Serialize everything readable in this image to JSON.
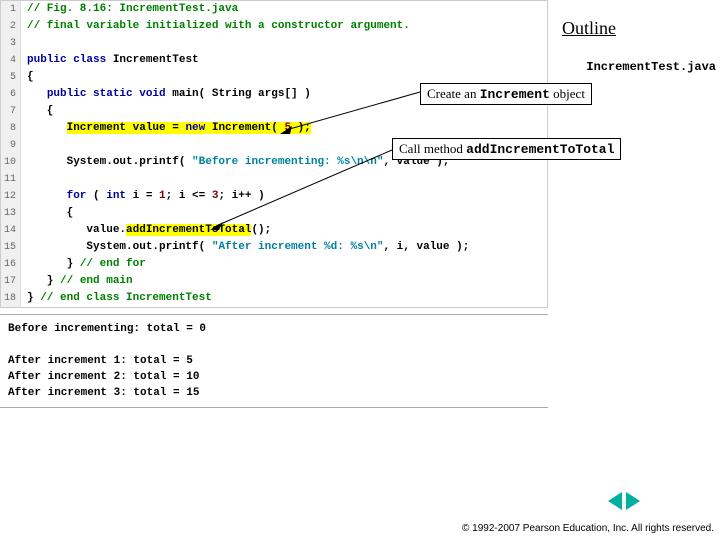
{
  "outline": "Outline",
  "filename": "IncrementTest.java",
  "code": [
    {
      "n": "1",
      "tokens": [
        {
          "t": "// Fig. 8.16: IncrementTest.java",
          "cls": "comment"
        }
      ]
    },
    {
      "n": "2",
      "tokens": [
        {
          "t": "// final variable initialized with a constructor argument.",
          "cls": "comment"
        }
      ]
    },
    {
      "n": "3",
      "tokens": []
    },
    {
      "n": "4",
      "tokens": [
        {
          "t": "public class ",
          "cls": "keyword"
        },
        {
          "t": "IncrementTest",
          "cls": "ident"
        }
      ]
    },
    {
      "n": "5",
      "tokens": [
        {
          "t": "{",
          "cls": "ident"
        }
      ]
    },
    {
      "n": "6",
      "tokens": [
        {
          "t": "   ",
          "cls": ""
        },
        {
          "t": "public static void ",
          "cls": "keyword"
        },
        {
          "t": "main",
          "cls": "ident"
        },
        {
          "t": "( String args[] )",
          "cls": "ident"
        }
      ]
    },
    {
      "n": "7",
      "tokens": [
        {
          "t": "   {",
          "cls": "ident"
        }
      ]
    },
    {
      "n": "8",
      "tokens": [
        {
          "t": "      ",
          "cls": ""
        },
        {
          "t": "Increment value = ",
          "cls": "ident hl"
        },
        {
          "t": "new ",
          "cls": "keyword hl"
        },
        {
          "t": "Increment( ",
          "cls": "ident hl"
        },
        {
          "t": "5",
          "cls": "num hl"
        },
        {
          "t": " );",
          "cls": "ident hl"
        }
      ]
    },
    {
      "n": "9",
      "tokens": []
    },
    {
      "n": "10",
      "tokens": [
        {
          "t": "      System.out.printf( ",
          "cls": "ident"
        },
        {
          "t": "\"Before incrementing: %s\\n\\n\"",
          "cls": "str"
        },
        {
          "t": ", value );",
          "cls": "ident"
        }
      ]
    },
    {
      "n": "11",
      "tokens": []
    },
    {
      "n": "12",
      "tokens": [
        {
          "t": "      ",
          "cls": ""
        },
        {
          "t": "for ",
          "cls": "keyword"
        },
        {
          "t": "( ",
          "cls": "ident"
        },
        {
          "t": "int ",
          "cls": "keyword"
        },
        {
          "t": "i = ",
          "cls": "ident"
        },
        {
          "t": "1",
          "cls": "num"
        },
        {
          "t": "; i <= ",
          "cls": "ident"
        },
        {
          "t": "3",
          "cls": "num"
        },
        {
          "t": "; i++ )",
          "cls": "ident"
        }
      ]
    },
    {
      "n": "13",
      "tokens": [
        {
          "t": "      {",
          "cls": "ident"
        }
      ]
    },
    {
      "n": "14",
      "tokens": [
        {
          "t": "         value.",
          "cls": "ident"
        },
        {
          "t": "addIncrementToTotal",
          "cls": "ident hl"
        },
        {
          "t": "();",
          "cls": "ident"
        }
      ]
    },
    {
      "n": "15",
      "tokens": [
        {
          "t": "         System.out.printf( ",
          "cls": "ident"
        },
        {
          "t": "\"After increment %d: %s\\n\"",
          "cls": "str"
        },
        {
          "t": ", i, value );",
          "cls": "ident"
        }
      ]
    },
    {
      "n": "16",
      "tokens": [
        {
          "t": "      } ",
          "cls": "ident"
        },
        {
          "t": "// end for",
          "cls": "comment"
        }
      ]
    },
    {
      "n": "17",
      "tokens": [
        {
          "t": "   } ",
          "cls": "ident"
        },
        {
          "t": "// end main",
          "cls": "comment"
        }
      ]
    },
    {
      "n": "18",
      "tokens": [
        {
          "t": "} ",
          "cls": "ident"
        },
        {
          "t": "// end class IncrementTest",
          "cls": "comment"
        }
      ]
    }
  ],
  "output": "Before incrementing: total = 0\n\nAfter increment 1: total = 5\nAfter increment 2: total = 10\nAfter increment 3: total = 15",
  "annot1": {
    "pre": "Create an ",
    "mono": "Increment",
    "post": " object"
  },
  "annot2": {
    "pre": "Call method ",
    "mono": "addIncrementToTotal"
  },
  "copyright": "© 1992-2007 Pearson Education, Inc.  All rights reserved."
}
